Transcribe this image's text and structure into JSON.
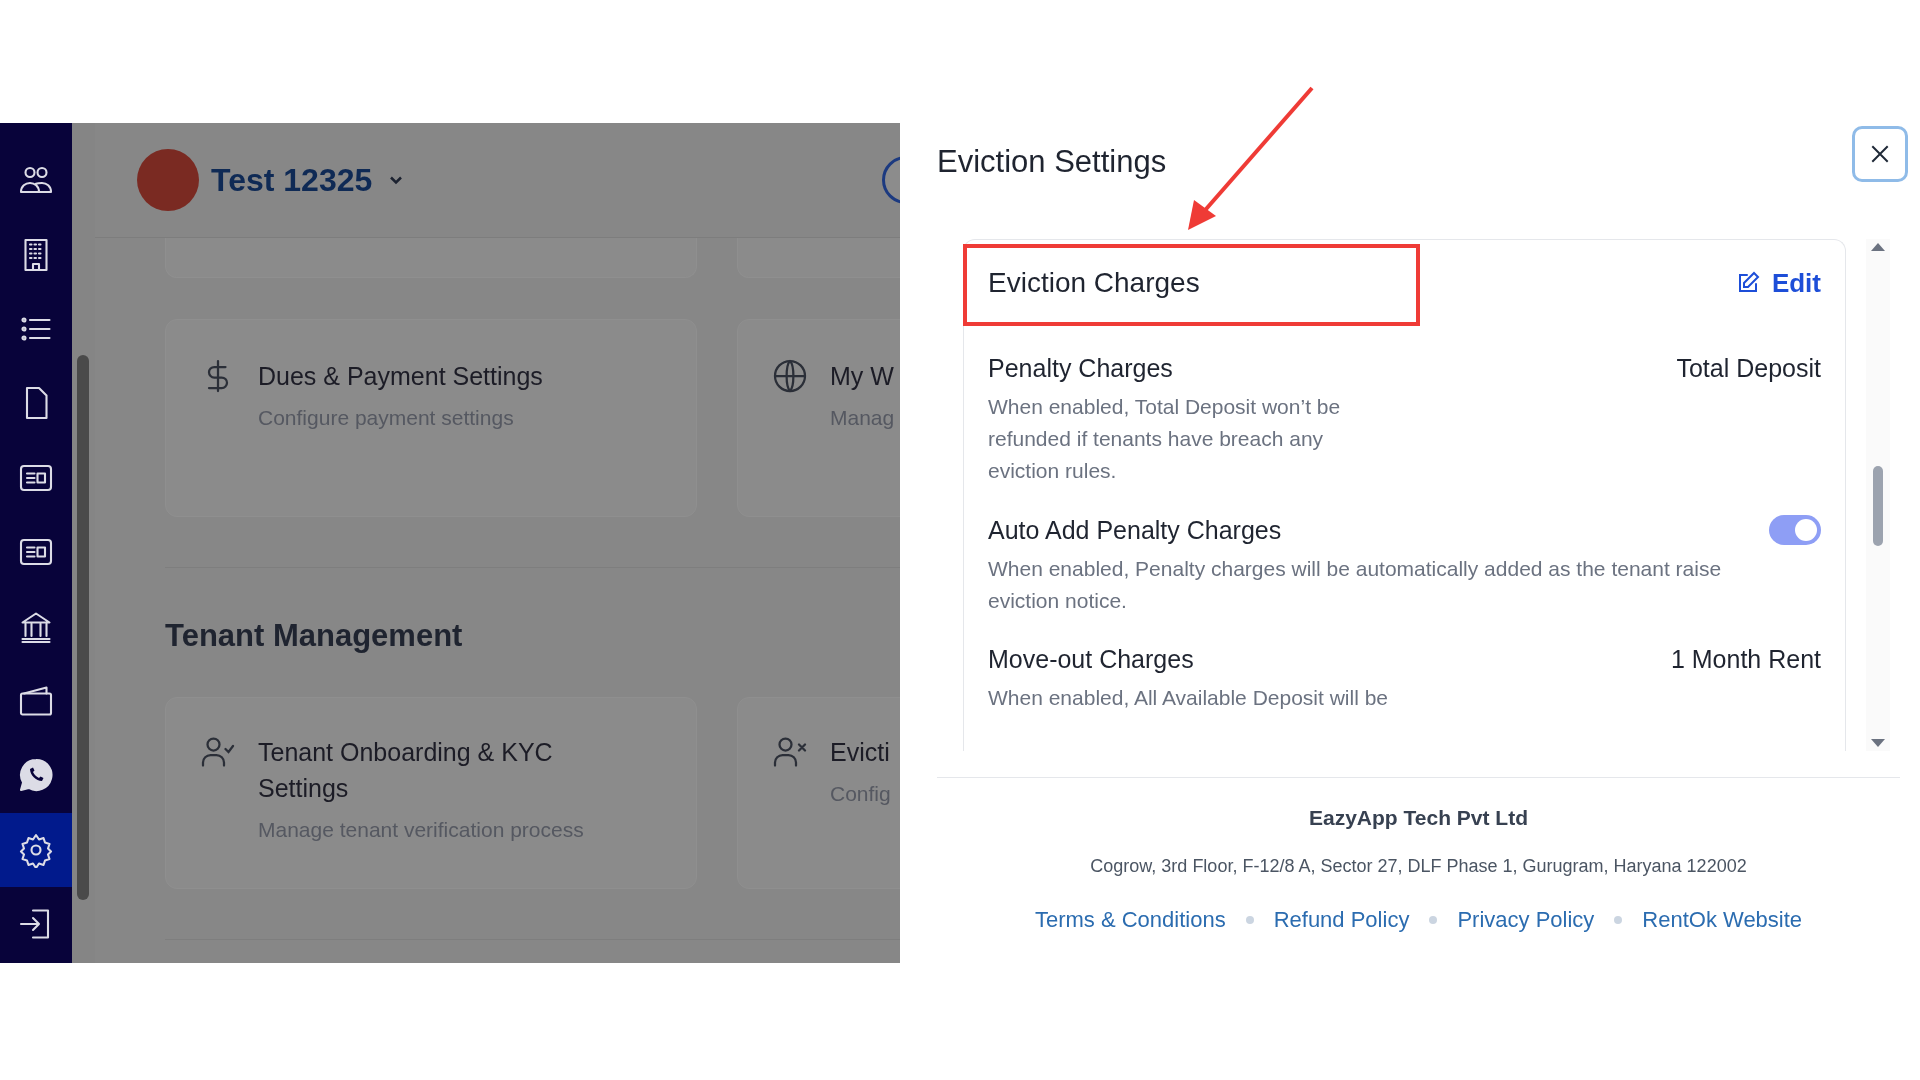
{
  "sidebar": {
    "items": [
      {
        "kind": "people",
        "selected": false
      },
      {
        "kind": "building",
        "selected": false
      },
      {
        "kind": "list",
        "selected": false
      },
      {
        "kind": "document",
        "selected": false
      },
      {
        "kind": "id-card",
        "selected": false
      },
      {
        "kind": "id-card",
        "selected": false
      },
      {
        "kind": "bank",
        "selected": false
      },
      {
        "kind": "wallet",
        "selected": false
      },
      {
        "kind": "chat",
        "selected": false
      },
      {
        "kind": "settings",
        "selected": true
      },
      {
        "kind": "logout",
        "selected": false
      }
    ]
  },
  "header": {
    "account": "Test 12325"
  },
  "settings_rows": [
    {
      "cards": [
        {
          "kind": "dollar",
          "title": "Dues & Payment Settings",
          "subtitle": "Configure payment settings"
        },
        {
          "kind": "globe",
          "title": "My W",
          "subtitle": "Manag"
        }
      ]
    }
  ],
  "section": {
    "title": "Tenant Management",
    "cards": [
      {
        "kind": "user-check",
        "title": "Tenant Onboarding & KYC Settings",
        "subtitle": "Manage tenant verification process"
      },
      {
        "kind": "user-x",
        "title": "Evicti",
        "subtitle": "Config"
      }
    ]
  },
  "panel": {
    "title": "Eviction Settings",
    "section": {
      "title": "Eviction Charges",
      "action": "Edit",
      "settings": [
        {
          "kind": "value",
          "label": "Penalty Charges",
          "value": "Total Deposit",
          "description": "When enabled, Total Deposit won’t be refunded if tenants have breach any eviction rules."
        },
        {
          "kind": "toggle",
          "label": "Auto Add Penalty Charges",
          "on": true,
          "description": "When enabled, Penalty charges will be automatically added as the tenant raise eviction notice."
        },
        {
          "kind": "value",
          "label": "Move-out Charges",
          "value": "1 Month Rent",
          "description": "When enabled, All Available Deposit will be"
        }
      ]
    }
  },
  "footer": {
    "company": "EazyApp Tech Pvt Ltd",
    "address": "Cogrow, 3rd Floor, F-12/8 A, Sector 27, DLF Phase 1, Gurugram, Haryana 122002",
    "links": [
      "Terms & Conditions",
      "Refund Policy",
      "Privacy Policy",
      "RentOk Website"
    ]
  }
}
